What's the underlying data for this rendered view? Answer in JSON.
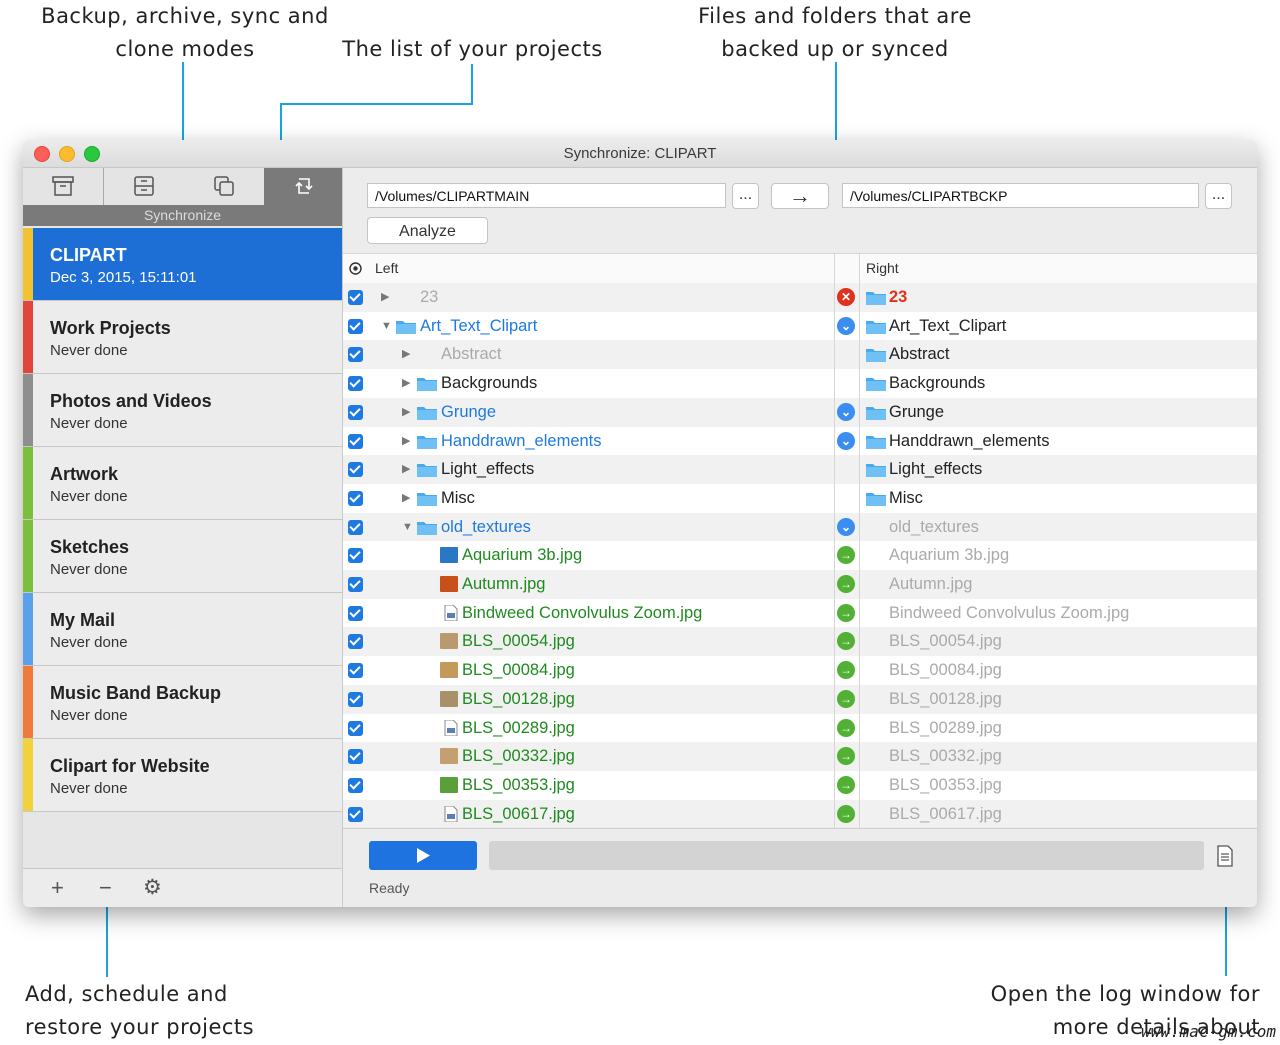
{
  "callouts": {
    "modes": "Backup, archive, sync and clone modes",
    "projects": "The list of your projects",
    "files": "Files and folders that are backed up or synced",
    "add": "Add, schedule and restore your projects",
    "log": "Open the log window for more details about"
  },
  "watermark": "www.mac-gm.com",
  "window": {
    "title": "Synchronize: CLIPART"
  },
  "modes": {
    "active_label": "Synchronize",
    "icons": [
      "archive-box-icon",
      "archive-drawer-icon",
      "clone-copy-icon",
      "sync-icon"
    ]
  },
  "projects": [
    {
      "name": "CLIPART",
      "date": "Dec 3, 2015, 15:11:01",
      "color": "#f2c230",
      "active": true
    },
    {
      "name": "Work Projects",
      "date": "Never done",
      "color": "#e0473a"
    },
    {
      "name": "Photos and Videos",
      "date": "Never done",
      "color": "#8e8e8e"
    },
    {
      "name": "Artwork",
      "date": "Never done",
      "color": "#7cbf3b"
    },
    {
      "name": "Sketches",
      "date": "Never done",
      "color": "#7cbf3b"
    },
    {
      "name": "My Mail",
      "date": "Never done",
      "color": "#5aa0ea"
    },
    {
      "name": "Music Band Backup",
      "date": "Never done",
      "color": "#f07a3a"
    },
    {
      "name": "Clipart for Website",
      "date": "Never done",
      "color": "#f2d23a"
    }
  ],
  "footer": {
    "add": "+",
    "remove": "−",
    "settings": "⚙"
  },
  "paths": {
    "left": "/Volumes/CLIPARTMAIN",
    "right": "/Volumes/CLIPARTBCKP",
    "browse": "...",
    "direction": "→"
  },
  "analyze": "Analyze",
  "table": {
    "left_header": "Left",
    "right_header": "Right"
  },
  "rows": [
    {
      "left": "23",
      "right": "23",
      "lcolor": "#aaaaaa",
      "rcolor": "#e0301e",
      "tri": "▶",
      "indent": 0,
      "ltype": "none",
      "rtype": "folder",
      "action": "error"
    },
    {
      "left": "Art_Text_Clipart",
      "right": "Art_Text_Clipart",
      "lcolor": "#1e7ae0",
      "rcolor": "#222222",
      "tri": "▼",
      "indent": 0,
      "ltype": "folder",
      "rtype": "folder",
      "action": "down"
    },
    {
      "left": "Abstract",
      "right": "Abstract",
      "lcolor": "#aaaaaa",
      "rcolor": "#222222",
      "tri": "▶",
      "indent": 1,
      "ltype": "none",
      "rtype": "folder",
      "action": ""
    },
    {
      "left": "Backgrounds",
      "right": "Backgrounds",
      "lcolor": "#222222",
      "rcolor": "#222222",
      "tri": "▶",
      "indent": 1,
      "ltype": "folder",
      "rtype": "folder",
      "action": ""
    },
    {
      "left": "Grunge",
      "right": "Grunge",
      "lcolor": "#1e7ae0",
      "rcolor": "#222222",
      "tri": "▶",
      "indent": 1,
      "ltype": "folder",
      "rtype": "folder",
      "action": "down"
    },
    {
      "left": "Handdrawn_elements",
      "right": "Handdrawn_elements",
      "lcolor": "#1e7ae0",
      "rcolor": "#222222",
      "tri": "▶",
      "indent": 1,
      "ltype": "folder",
      "rtype": "folder",
      "action": "down"
    },
    {
      "left": "Light_effects",
      "right": "Light_effects",
      "lcolor": "#222222",
      "rcolor": "#222222",
      "tri": "▶",
      "indent": 1,
      "ltype": "folder",
      "rtype": "folder",
      "action": ""
    },
    {
      "left": "Misc",
      "right": "Misc",
      "lcolor": "#222222",
      "rcolor": "#222222",
      "tri": "▶",
      "indent": 1,
      "ltype": "folder",
      "rtype": "folder",
      "action": ""
    },
    {
      "left": "old_textures",
      "right": "old_textures",
      "lcolor": "#1e7ae0",
      "rcolor": "#aaaaaa",
      "tri": "▼",
      "indent": 1,
      "ltype": "folder",
      "rtype": "none",
      "action": "down"
    },
    {
      "left": "Aquarium 3b.jpg",
      "right": "Aquarium 3b.jpg",
      "lcolor": "#1f8a1f",
      "rcolor": "#aaaaaa",
      "tri": "",
      "indent": 2,
      "ltype": "file",
      "fcolor": "#2a77c4",
      "rtype": "none",
      "action": "right"
    },
    {
      "left": "Autumn.jpg",
      "right": "Autumn.jpg",
      "lcolor": "#1f8a1f",
      "rcolor": "#aaaaaa",
      "tri": "",
      "indent": 2,
      "ltype": "file",
      "fcolor": "#c8501a",
      "rtype": "none",
      "action": "right"
    },
    {
      "left": "Bindweed Convolvulus Zoom.jpg",
      "right": "Bindweed Convolvulus Zoom.jpg",
      "lcolor": "#1f8a1f",
      "rcolor": "#aaaaaa",
      "tri": "",
      "indent": 2,
      "ltype": "doc",
      "rtype": "none",
      "action": "right"
    },
    {
      "left": "BLS_00054.jpg",
      "right": "BLS_00054.jpg",
      "lcolor": "#1f8a1f",
      "rcolor": "#aaaaaa",
      "tri": "",
      "indent": 2,
      "ltype": "file",
      "fcolor": "#b99a6e",
      "rtype": "none",
      "action": "right"
    },
    {
      "left": "BLS_00084.jpg",
      "right": "BLS_00084.jpg",
      "lcolor": "#1f8a1f",
      "rcolor": "#aaaaaa",
      "tri": "",
      "indent": 2,
      "ltype": "file",
      "fcolor": "#c49a5a",
      "rtype": "none",
      "action": "right"
    },
    {
      "left": "BLS_00128.jpg",
      "right": "BLS_00128.jpg",
      "lcolor": "#1f8a1f",
      "rcolor": "#aaaaaa",
      "tri": "",
      "indent": 2,
      "ltype": "file",
      "fcolor": "#a8906a",
      "rtype": "none",
      "action": "right"
    },
    {
      "left": "BLS_00289.jpg",
      "right": "BLS_00289.jpg",
      "lcolor": "#1f8a1f",
      "rcolor": "#aaaaaa",
      "tri": "",
      "indent": 2,
      "ltype": "doc",
      "rtype": "none",
      "action": "right"
    },
    {
      "left": "BLS_00332.jpg",
      "right": "BLS_00332.jpg",
      "lcolor": "#1f8a1f",
      "rcolor": "#aaaaaa",
      "tri": "",
      "indent": 2,
      "ltype": "file",
      "fcolor": "#c4a070",
      "rtype": "none",
      "action": "right"
    },
    {
      "left": "BLS_00353.jpg",
      "right": "BLS_00353.jpg",
      "lcolor": "#1f8a1f",
      "rcolor": "#aaaaaa",
      "tri": "",
      "indent": 2,
      "ltype": "file",
      "fcolor": "#5aa03a",
      "rtype": "none",
      "action": "right"
    },
    {
      "left": "BLS_00617.jpg",
      "right": "BLS_00617.jpg",
      "lcolor": "#1f8a1f",
      "rcolor": "#aaaaaa",
      "tri": "",
      "indent": 2,
      "ltype": "doc",
      "rtype": "none",
      "action": "right"
    }
  ],
  "status": "Ready"
}
